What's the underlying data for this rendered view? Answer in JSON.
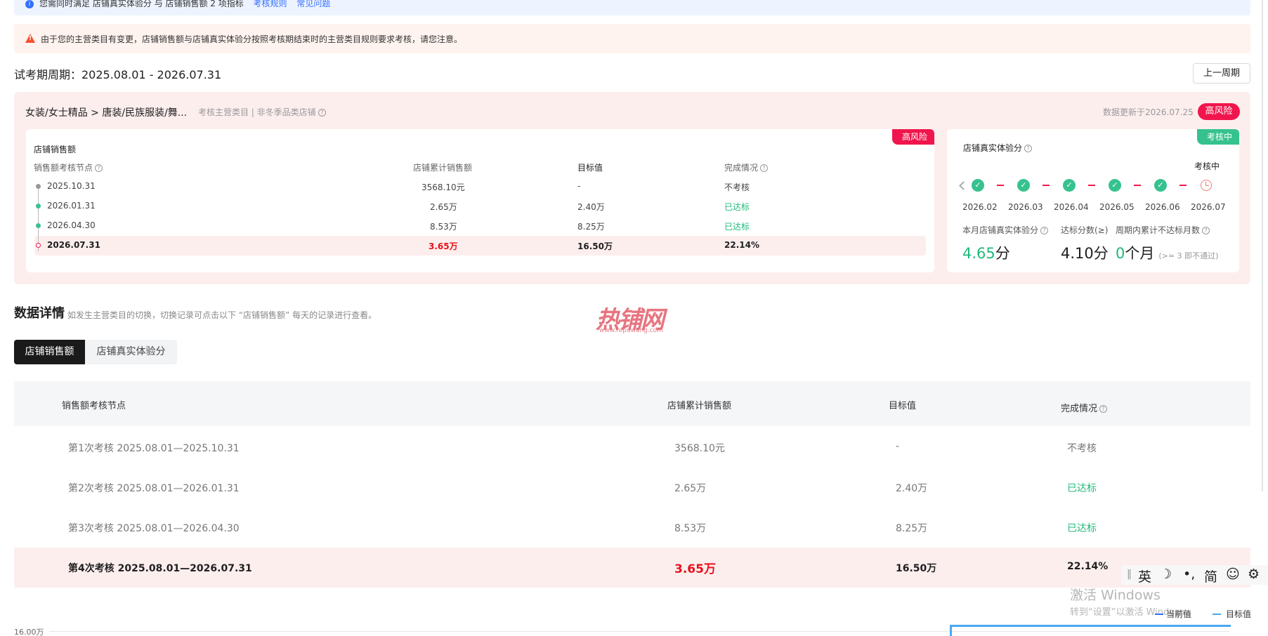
{
  "info_bar": {
    "text": "您需同时满足 店铺真实体验分 与 店铺销售额 2 项指标",
    "link1": "考核规则",
    "link2": "常见问题"
  },
  "warning": "由于您的主营类目有变更，店铺销售额与店铺真实体验分按照考核期结束时的主营类目规则要求考核，请您注意。",
  "period_label": "试考期周期：2025.08.01 - 2026.07.31",
  "prev_period_button": "上一周期",
  "category": {
    "breadcrumb": "女装/女士精品 > 唐装/民族服装/舞...",
    "sub": "考核主营类目 | 非冬季品类店铺",
    "updated": "数据更新于2026.07.25",
    "risk_badge": "高风险"
  },
  "sales_card": {
    "tag": "高风险",
    "title": "店铺销售额",
    "headers": [
      "销售额考核节点",
      "店铺累计销售额",
      "目标值",
      "完成情况"
    ],
    "rows": [
      {
        "date": "2025.10.31",
        "sales": "3568.10元",
        "target": "-",
        "status": "不考核"
      },
      {
        "date": "2026.01.31",
        "sales": "2.65万",
        "target": "2.40万",
        "status": "已达标"
      },
      {
        "date": "2026.04.30",
        "sales": "8.53万",
        "target": "8.25万",
        "status": "已达标"
      },
      {
        "date": "2026.07.31",
        "sales": "3.65万",
        "target": "16.50万",
        "status": "22.14%"
      }
    ]
  },
  "real_card": {
    "tag": "考核中",
    "title": "店铺真实体验分",
    "status_label": "考核中",
    "months": [
      "2026.02",
      "2026.03",
      "2026.04",
      "2026.05",
      "2026.06",
      "2026.07"
    ],
    "labels": {
      "current": "本月店铺真实体验分",
      "standard": "达标分数(≥)",
      "cumulative": "周期内累计不达标月数"
    },
    "values": {
      "current": "4.65",
      "current_unit": "分",
      "standard": "4.10分",
      "cumulative": "0",
      "cumulative_unit": "个月",
      "cumulative_note": "(>= 3 即不通过)"
    }
  },
  "details": {
    "title": "数据详情",
    "subtitle": "如发生主营类目的切换，切换记录可点击以下 “店铺销售额” 每天的记录进行查看。",
    "tabs": [
      "店铺销售额",
      "店铺真实体验分"
    ],
    "headers": [
      "销售额考核节点",
      "店铺累计销售额",
      "目标值",
      "完成情况"
    ],
    "rows": [
      {
        "node": "第1次考核 2025.08.01—2025.10.31",
        "sales": "3568.10元",
        "target": "-",
        "status": "不考核"
      },
      {
        "node": "第2次考核 2025.08.01—2026.01.31",
        "sales": "2.65万",
        "target": "2.40万",
        "status": "已达标"
      },
      {
        "node": "第3次考核 2025.08.01—2026.04.30",
        "sales": "8.53万",
        "target": "8.25万",
        "status": "已达标"
      },
      {
        "node": "第4次考核 2025.08.01—2026.07.31",
        "sales": "3.65万",
        "target": "16.50万",
        "status": "22.14%"
      }
    ]
  },
  "chart": {
    "y_label": "16.00万",
    "legend_current": "当前值",
    "legend_target": "目标值",
    "colors": {
      "current": "#3370ff",
      "target": "#4aa8f0"
    }
  },
  "watermark": {
    "text": "热铺网",
    "url": "www.repuwang.com"
  },
  "ime": {
    "lang": "英",
    "moon": "☽",
    "punct": "•,",
    "simp": "简",
    "emoji": "☺",
    "gear": "⚙"
  },
  "windows": {
    "line1": "激活 Windows",
    "line2": "转到“设置”以激活 Windows。"
  },
  "colors": {
    "risk": "#f0164d",
    "ok": "#1fba7a",
    "panel": "#fdeeee"
  }
}
